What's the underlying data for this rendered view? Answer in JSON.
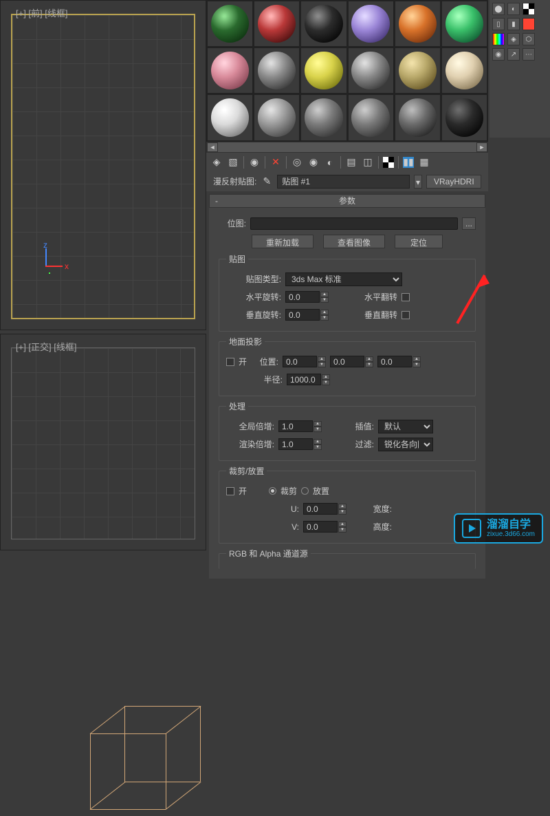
{
  "viewports": {
    "top_label": "[+] [前] [线框]",
    "bottom_label": "[+] [正交] [线框]"
  },
  "material": {
    "swatches": [
      {
        "c": "#2a6a2e",
        "hl": "#8fe090",
        "sh": "#0a2a0c"
      },
      {
        "c": "#b93838",
        "hl": "#ffb0b0",
        "sh": "#3a0a0a"
      },
      {
        "c": "#2c2c2c",
        "hl": "#888",
        "sh": "#000"
      },
      {
        "c": "#9a85d6",
        "hl": "#e0d6ff",
        "sh": "#3a2a6a"
      },
      {
        "c": "#d8722a",
        "hl": "#ffcd90",
        "sh": "#6a2a0a"
      },
      {
        "c": "#3ac06a",
        "hl": "#a0ffb8",
        "sh": "#0a4a2a"
      },
      {
        "c": "#d88a9a",
        "hl": "#ffd0da",
        "sh": "#7a3a4a"
      },
      {
        "c": "#8a8a8a",
        "hl": "#ddd",
        "sh": "#2a2a2a"
      },
      {
        "c": "#d8d24a",
        "hl": "#fffa90",
        "sh": "#6a6a0a"
      },
      {
        "c": "#8a8a8a",
        "hl": "#ddd",
        "sh": "#2a2a2a"
      },
      {
        "c": "#b8a86a",
        "hl": "#f0e0a8",
        "sh": "#5a4a1a"
      },
      {
        "c": "#e0d0b0",
        "hl": "#fff8e0",
        "sh": "#7a6a4a"
      },
      {
        "c": "#dadada",
        "hl": "#fff",
        "sh": "#6a6a6a"
      },
      {
        "c": "#9a9a9a",
        "hl": "#e0e0e0",
        "sh": "#3a3a3a"
      },
      {
        "c": "#7a7a7a",
        "hl": "#c8c8c8",
        "sh": "#2a2a2a"
      },
      {
        "c": "#7a7a7a",
        "hl": "#c8c8c8",
        "sh": "#2a2a2a"
      },
      {
        "c": "#6a6a6a",
        "hl": "#b8b8b8",
        "sh": "#1a1a1a"
      },
      {
        "c": "#2a2a2a",
        "hl": "#6a6a6a",
        "sh": "#000"
      }
    ],
    "map_label": "漫反射贴图:",
    "map_name": "贴图 #1",
    "map_type": "VRayHDRI"
  },
  "params": {
    "header": "参数",
    "bitmap_label": "位图:",
    "btn_reload": "重新加载",
    "btn_view": "查看图像",
    "btn_locate": "定位",
    "dots": "...",
    "group_map": "贴图",
    "maptype_label": "贴图类型:",
    "maptype_value": "3ds Max 标准",
    "hrot_label": "水平旋转:",
    "hrot_value": "0.0",
    "hflip_label": "水平翻转",
    "vrot_label": "垂直旋转:",
    "vrot_value": "0.0",
    "vflip_label": "垂直翻转",
    "group_ground": "地面投影",
    "ground_on": "开",
    "pos_label": "位置:",
    "pos_x": "0.0",
    "pos_y": "0.0",
    "pos_z": "0.0",
    "radius_label": "半径:",
    "radius_value": "1000.0",
    "group_process": "处理",
    "global_mult_label": "全局倍增:",
    "global_mult_value": "1.0",
    "render_mult_label": "渲染倍增:",
    "render_mult_value": "1.0",
    "interp_label": "插值:",
    "interp_value": "默认",
    "filter_label": "过滤:",
    "filter_value": "锐化各向同",
    "group_crop": "裁剪/放置",
    "crop_on": "开",
    "crop_opt": "裁剪",
    "place_opt": "放置",
    "u_label": "U:",
    "u_value": "0.0",
    "v_label": "V:",
    "v_value": "0.0",
    "width_label": "宽度:",
    "height_label": "高度:",
    "group_rgb": "RGB 和 Alpha 通道源"
  },
  "watermark": {
    "title": "溜溜自学",
    "sub": "zixue.3d66.com"
  }
}
